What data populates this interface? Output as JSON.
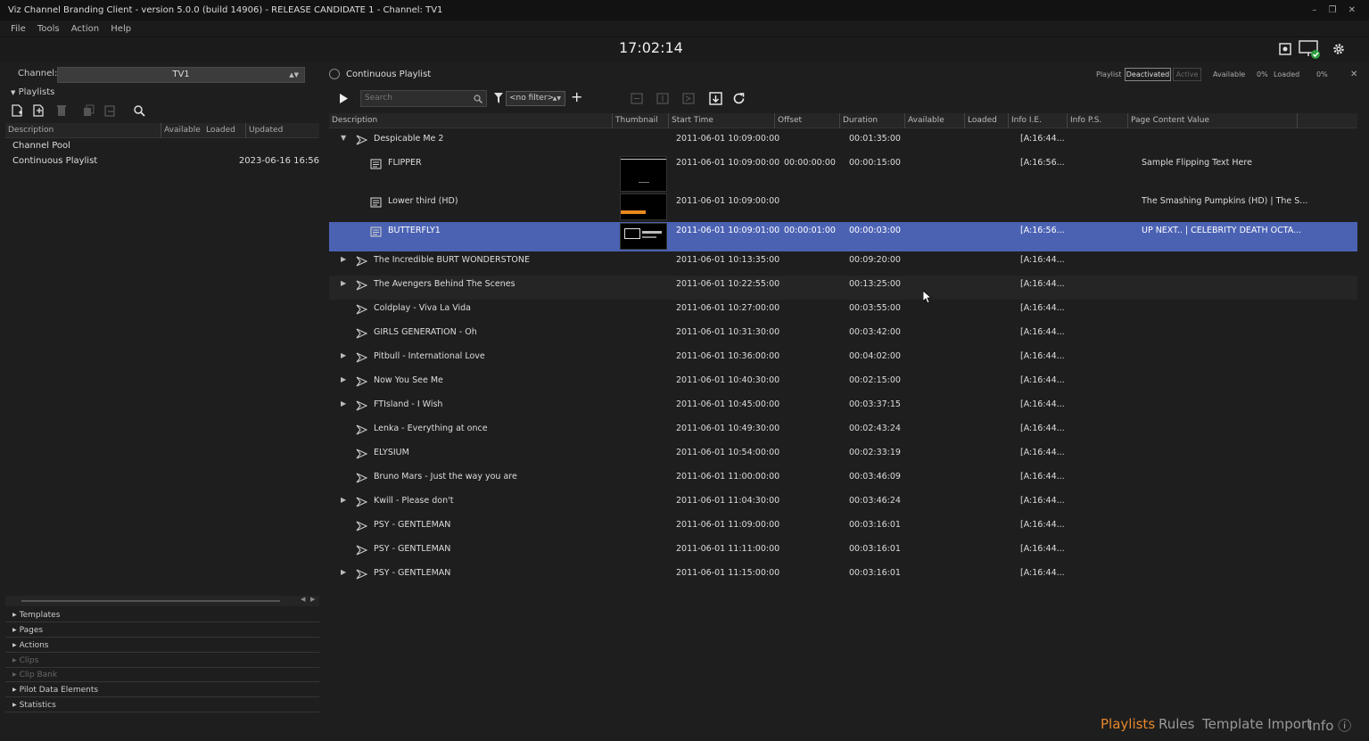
{
  "window": {
    "title": "Viz Channel Branding Client - version 5.0.0 (build 14906) - RELEASE CANDIDATE 1 - Channel: TV1",
    "controls": "– ❐ ✕"
  },
  "menu": [
    "File",
    "Tools",
    "Action",
    "Help"
  ],
  "clock": "17:02:14",
  "left": {
    "channel_label": "Channel:",
    "channel_value": "TV1",
    "playlists_header": "Playlists",
    "columns": [
      "Description",
      "Available",
      "Loaded",
      "Updated"
    ],
    "rows": [
      {
        "name": "Channel Pool",
        "updated": ""
      },
      {
        "name": "Continuous Playlist",
        "updated": "2023-06-16 16:56"
      }
    ],
    "sections": [
      "Templates",
      "Pages",
      "Actions",
      "Clips",
      "Clip Bank",
      "Pilot Data Elements",
      "Statistics"
    ]
  },
  "playlist": {
    "title": "Continuous Playlist",
    "status_label": "Playlist",
    "status_deactivated": "Deactivated",
    "status_active": "Active",
    "available_label": "Available",
    "available_value": "0%",
    "loaded_label": "Loaded",
    "loaded_value": "0%",
    "close": "✕",
    "search_placeholder": "Search",
    "filter_value": "<no filter>",
    "columns": [
      "Description",
      "Thumbnail",
      "Start Time",
      "Offset",
      "Duration",
      "Available",
      "Loaded",
      "Info I.E.",
      "Info P.S.",
      "Page Content Value"
    ],
    "rows": [
      {
        "desc": "Despicable Me 2",
        "start": "2011-06-01 10:09:00:00",
        "offset": "",
        "dur": "00:01:35:00",
        "info": "[A:16:44...",
        "pcv": "",
        "exp": "▼",
        "level": 0,
        "kind": "group"
      },
      {
        "desc": "FLIPPER",
        "start": "2011-06-01 10:09:00:00",
        "offset": "00:00:00:00",
        "dur": "00:00:15:00",
        "info": "[A:16:56...",
        "pcv": "Sample Flipping Text Here",
        "exp": "",
        "level": 1,
        "kind": "page"
      },
      {
        "desc": "Lower third (HD)",
        "start": "2011-06-01 10:09:00:00",
        "offset": "",
        "dur": "",
        "info": "",
        "pcv": "The Smashing Pumpkins (HD) | The S...",
        "exp": "",
        "level": 1,
        "kind": "page"
      },
      {
        "desc": "BUTTERFLY1",
        "start": "2011-06-01 10:09:01:00",
        "offset": "00:00:01:00",
        "dur": "00:00:03:00",
        "info": "[A:16:56...",
        "pcv": "UP NEXT.. | CELEBRITY DEATH OCTA...",
        "exp": "",
        "level": 1,
        "kind": "page"
      },
      {
        "desc": "The Incredible BURT WONDERSTONE",
        "start": "2011-06-01 10:13:35:00",
        "offset": "",
        "dur": "00:09:20:00",
        "info": "[A:16:44...",
        "pcv": "",
        "exp": "▶",
        "level": 0,
        "kind": "group"
      },
      {
        "desc": "The Avengers Behind The Scenes",
        "start": "2011-06-01 10:22:55:00",
        "offset": "",
        "dur": "00:13:25:00",
        "info": "[A:16:44...",
        "pcv": "",
        "exp": "▶",
        "level": 0,
        "kind": "group"
      },
      {
        "desc": "Coldplay - Viva La Vida",
        "start": "2011-06-01 10:27:00:00",
        "offset": "",
        "dur": "00:03:55:00",
        "info": "[A:16:44...",
        "pcv": "",
        "exp": "",
        "level": 0,
        "kind": "group"
      },
      {
        "desc": "GIRLS GENERATION - Oh",
        "start": "2011-06-01 10:31:30:00",
        "offset": "",
        "dur": "00:03:42:00",
        "info": "[A:16:44...",
        "pcv": "",
        "exp": "",
        "level": 0,
        "kind": "group"
      },
      {
        "desc": "Pitbull - International Love",
        "start": "2011-06-01 10:36:00:00",
        "offset": "",
        "dur": "00:04:02:00",
        "info": "[A:16:44...",
        "pcv": "",
        "exp": "▶",
        "level": 0,
        "kind": "group"
      },
      {
        "desc": "Now You See Me",
        "start": "2011-06-01 10:40:30:00",
        "offset": "",
        "dur": "00:02:15:00",
        "info": "[A:16:44...",
        "pcv": "",
        "exp": "▶",
        "level": 0,
        "kind": "group"
      },
      {
        "desc": "FTIsland - I Wish",
        "start": "2011-06-01 10:45:00:00",
        "offset": "",
        "dur": "00:03:37:15",
        "info": "[A:16:44...",
        "pcv": "",
        "exp": "▶",
        "level": 0,
        "kind": "group"
      },
      {
        "desc": "Lenka - Everything at once",
        "start": "2011-06-01 10:49:30:00",
        "offset": "",
        "dur": "00:02:43:24",
        "info": "[A:16:44...",
        "pcv": "",
        "exp": "",
        "level": 0,
        "kind": "group"
      },
      {
        "desc": "ELYSIUM",
        "start": "2011-06-01 10:54:00:00",
        "offset": "",
        "dur": "00:02:33:19",
        "info": "[A:16:44...",
        "pcv": "",
        "exp": "",
        "level": 0,
        "kind": "group"
      },
      {
        "desc": "Bruno Mars - Just the way you are",
        "start": "2011-06-01 11:00:00:00",
        "offset": "",
        "dur": "00:03:46:09",
        "info": "[A:16:44...",
        "pcv": "",
        "exp": "",
        "level": 0,
        "kind": "group"
      },
      {
        "desc": "Kwill - Please don't",
        "start": "2011-06-01 11:04:30:00",
        "offset": "",
        "dur": "00:03:46:24",
        "info": "[A:16:44...",
        "pcv": "",
        "exp": "▶",
        "level": 0,
        "kind": "group"
      },
      {
        "desc": "PSY - GENTLEMAN",
        "start": "2011-06-01 11:09:00:00",
        "offset": "",
        "dur": "00:03:16:01",
        "info": "[A:16:44...",
        "pcv": "",
        "exp": "",
        "level": 0,
        "kind": "group"
      },
      {
        "desc": "PSY - GENTLEMAN",
        "start": "2011-06-01 11:11:00:00",
        "offset": "",
        "dur": "00:03:16:01",
        "info": "[A:16:44...",
        "pcv": "",
        "exp": "",
        "level": 0,
        "kind": "group"
      },
      {
        "desc": "PSY - GENTLEMAN",
        "start": "2011-06-01 11:15:00:00",
        "offset": "",
        "dur": "00:03:16:01",
        "info": "[A:16:44...",
        "pcv": "",
        "exp": "▶",
        "level": 0,
        "kind": "group"
      }
    ]
  },
  "footer": {
    "tabs": [
      "Playlists",
      "Rules",
      "Template Import",
      "Info ⓘ"
    ]
  },
  "colors": {
    "selection": "#4b62b3",
    "accent": "#e8882a"
  }
}
